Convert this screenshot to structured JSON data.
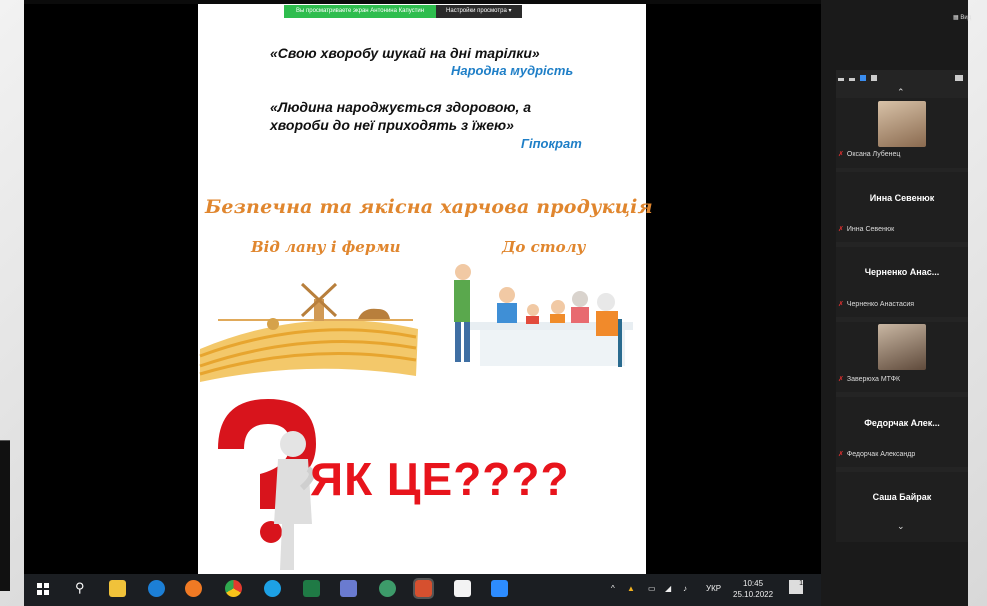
{
  "banner": {
    "viewing": "Вы просматриваете экран Антонина Капустин",
    "settings": "Настройки просмотра"
  },
  "slide": {
    "quote1": "«Свою хворобу шукай на дні тарілки»",
    "author1": "Народна мудрість",
    "quote2_line1": "«Людина народжується здоровою, а",
    "quote2_line2": "хвороби до неї приходять з їжею»",
    "author2": "Гіпократ",
    "heading": "Безпечна та якісна харчова продукція",
    "from_farm": "Від лану і ферми",
    "to_table": "До столу",
    "question": "ЯК ЦЕ????"
  },
  "zoom": {
    "view_button": "Вид",
    "participants": [
      {
        "tile_name": "",
        "label": "Оксана Лубенец"
      },
      {
        "tile_name": "Инна Севенюк",
        "label": "Инна Севенюк"
      },
      {
        "tile_name": "Черненко Анас...",
        "label": "Черненко Анастасия"
      },
      {
        "tile_name": "",
        "label": "Заверюха МТФК"
      },
      {
        "tile_name": "Федорчак Алек...",
        "label": "Федорчак Александр"
      },
      {
        "tile_name": "Саша Байрак",
        "label": ""
      }
    ]
  },
  "taskbar": {
    "language": "УКР",
    "time": "10:45",
    "date": "25.10.2022",
    "notification_count": "1"
  },
  "colors": {
    "accent_orange": "#e0862e",
    "author_blue": "#1f7fc7",
    "question_red": "#e8141c",
    "zoom_green": "#2ebd4e"
  }
}
